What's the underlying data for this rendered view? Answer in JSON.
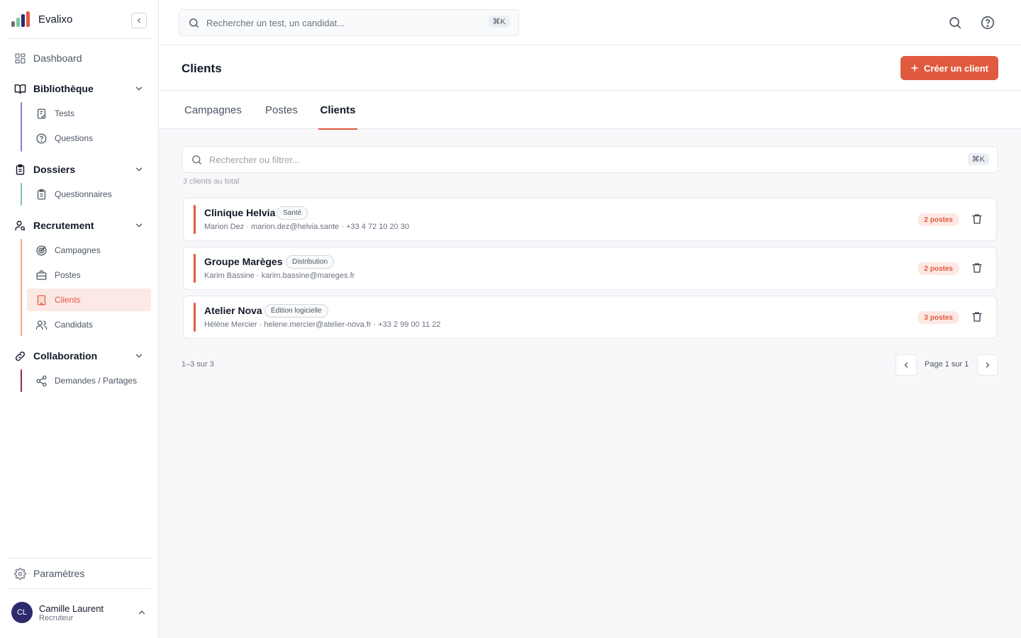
{
  "brand": {
    "name": "Evalixo"
  },
  "sidebar": {
    "dashboard": "Dashboard",
    "groups": {
      "bibliotheque": {
        "label": "Bibliothèque",
        "items": [
          "Tests",
          "Questions"
        ]
      },
      "dossiers": {
        "label": "Dossiers",
        "items": [
          "Questionnaires"
        ]
      },
      "recrutement": {
        "label": "Recrutement",
        "items": [
          "Campagnes",
          "Postes",
          "Clients",
          "Candidats"
        ]
      },
      "collaboration": {
        "label": "Collaboration",
        "items": [
          "Demandes / Partages"
        ]
      }
    },
    "active_item": "Clients",
    "settings": "Paramètres",
    "user": {
      "initials": "CL",
      "name": "Camille Laurent",
      "role": "Recruteur"
    }
  },
  "topbar": {
    "search_placeholder": "Rechercher un test, un candidat...",
    "shortcut": "⌘K"
  },
  "page": {
    "title": "Clients",
    "create_label": "Créer un client"
  },
  "tabs": [
    "Campagnes",
    "Postes",
    "Clients"
  ],
  "active_tab": "Clients",
  "filter": {
    "placeholder": "Rechercher ou filtrer...",
    "shortcut": "⌘K"
  },
  "total_label": "3 clients au total",
  "clients": [
    {
      "name": "Clinique Helvia",
      "sector": "Santé",
      "contact": "Marion Dez · marion.dez@helvia.sante · +33 4 72 10 20 30",
      "posts": "2 postes"
    },
    {
      "name": "Groupe Marèges",
      "sector": "Distribution",
      "contact": "Karim Bassine · karim.bassine@mareges.fr",
      "posts": "2 postes"
    },
    {
      "name": "Atelier Nova",
      "sector": "Édition logicielle",
      "contact": "Hélène Mercier · helene.mercier@atelier-nova.fr · +33 2 99 00 11 22",
      "posts": "3 postes"
    }
  ],
  "pagination": {
    "range": "1–3 sur 3",
    "page_label": "Page 1 sur 1"
  },
  "colors": {
    "accent": "#e05a3f",
    "avatar": "#2d2a6e",
    "rail_bibliotheque": "#8b7fd1",
    "rail_dossiers": "#7cc6a4",
    "rail_recrutement": "#f1a58f",
    "rail_collaboration": "#8e2a4f"
  }
}
